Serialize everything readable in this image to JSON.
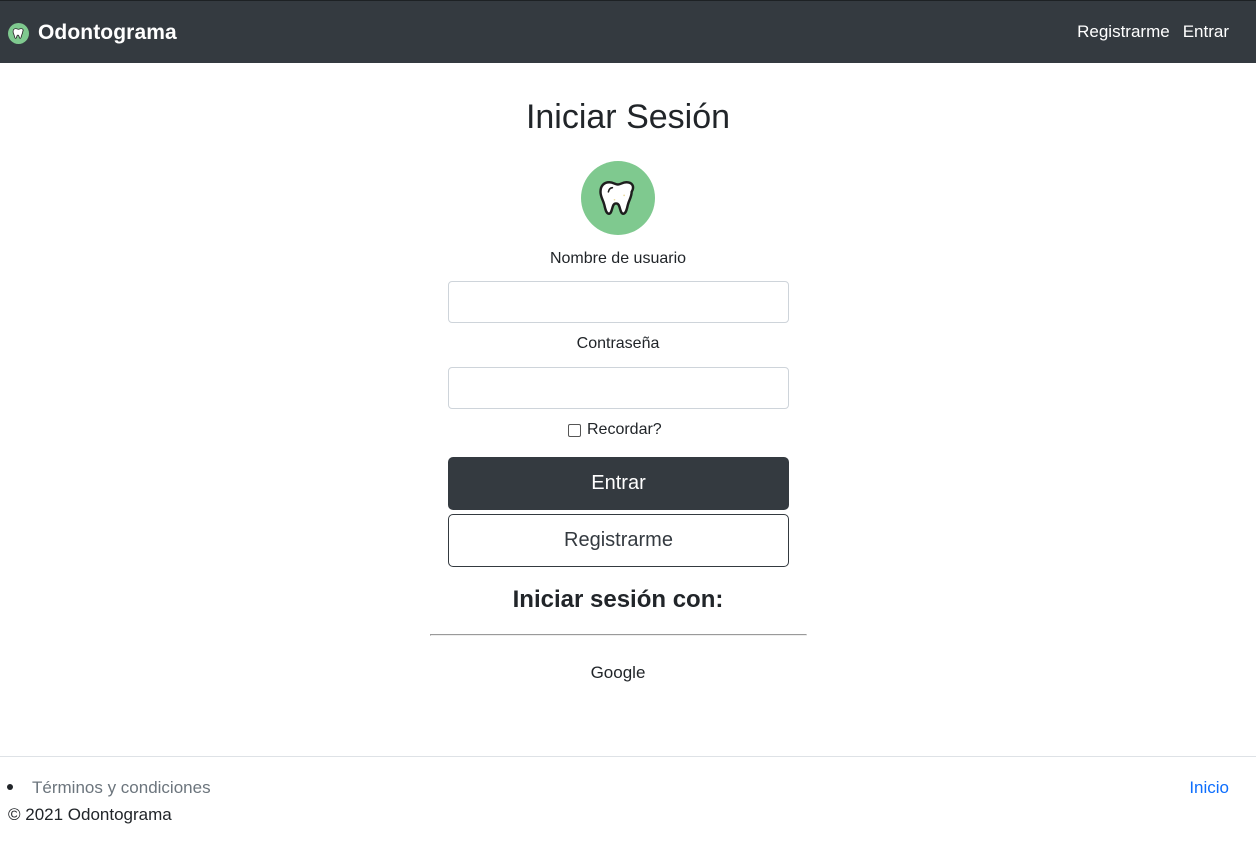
{
  "navbar": {
    "brand": "Odontograma",
    "links": {
      "register": "Registrarme",
      "login": "Entrar"
    }
  },
  "login": {
    "title": "Iniciar Sesión",
    "username_label": "Nombre de usuario",
    "username_value": "",
    "password_label": "Contraseña",
    "password_value": "",
    "remember_label": "Recordar?",
    "remember_checked": false,
    "submit_label": "Entrar",
    "register_label": "Registrarme"
  },
  "external_login": {
    "title": "Iniciar sesión con:",
    "providers": [
      "Google"
    ]
  },
  "footer": {
    "terms_link": "Términos y condiciones",
    "copyright": "© 2021 Odontograma",
    "home_link": "Inicio"
  },
  "colors": {
    "navbar_bg": "#343a40",
    "brand_green": "#7fc98f",
    "link_blue": "#0d6efd",
    "muted": "#6c757d"
  },
  "icons": {
    "brand": "tooth-icon",
    "avatar": "tooth-icon"
  }
}
